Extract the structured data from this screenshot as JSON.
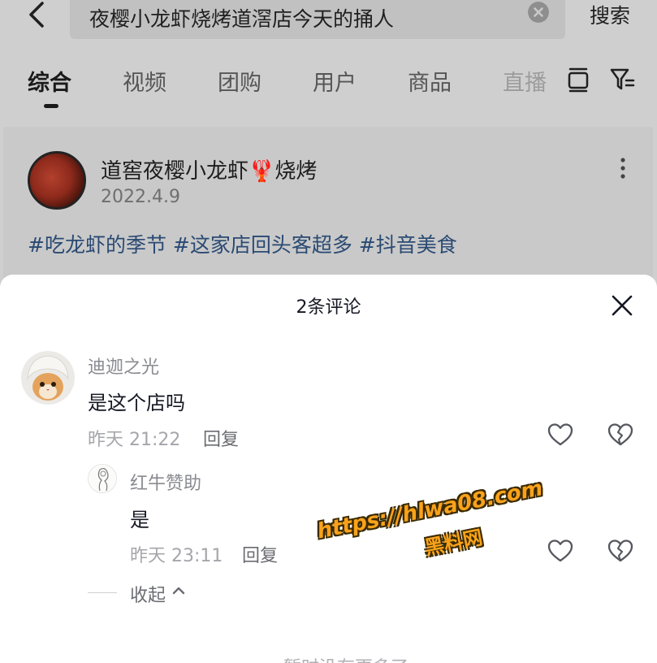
{
  "search": {
    "query": "夜樱小龙虾烧烤道滘店今天的捅人",
    "button_label": "搜索"
  },
  "tabs": [
    {
      "label": "综合",
      "active": true
    },
    {
      "label": "视频",
      "active": false
    },
    {
      "label": "团购",
      "active": false
    },
    {
      "label": "用户",
      "active": false
    },
    {
      "label": "商品",
      "active": false
    },
    {
      "label": "直播",
      "active": false
    }
  ],
  "card": {
    "title": "道窖夜樱小龙虾🦞烧烤",
    "date": "2022.4.9",
    "tags": "#吃龙虾的季节 #这家店回头客超多 #抖音美食"
  },
  "sheet": {
    "title": "2条评论",
    "comments": [
      {
        "user": "迪迦之光",
        "text": "是这个店吗",
        "time": "昨天 21:22",
        "reply_label": "回复"
      },
      {
        "user": "红牛赞助",
        "text": "是",
        "time": "昨天 23:11",
        "reply_label": "回复"
      }
    ],
    "collapse_label": "收起",
    "footer_partial": "— 暂时没有更多了 —"
  },
  "watermark": {
    "url": "https://hlwa08.com",
    "text": "黑料网"
  },
  "colors": {
    "tag_blue": "#2a4a73",
    "watermark_orange": "#f9a21a"
  },
  "icons": [
    "back-icon",
    "clear-icon",
    "layout-icon",
    "filter-icon",
    "more-icon",
    "close-icon",
    "heart-icon",
    "broken-heart-icon",
    "chevron-up-icon"
  ]
}
